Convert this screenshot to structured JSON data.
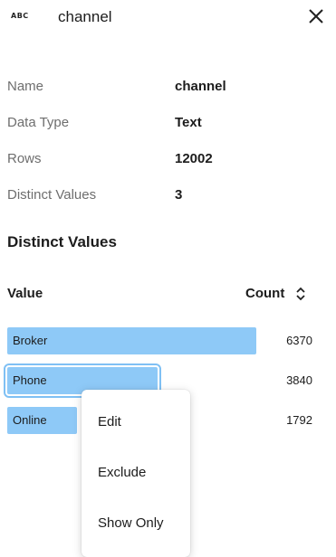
{
  "header": {
    "type_badge": "ABC",
    "title": "channel"
  },
  "properties": [
    {
      "label": "Name",
      "value": "channel"
    },
    {
      "label": "Data Type",
      "value": "Text"
    },
    {
      "label": "Rows",
      "value": "12002"
    },
    {
      "label": "Distinct Values",
      "value": "3"
    }
  ],
  "distinct": {
    "section_title": "Distinct Values",
    "value_header": "Value",
    "count_header": "Count",
    "max_count": 6370,
    "rows": [
      {
        "label": "Broker",
        "count": 6370
      },
      {
        "label": "Phone",
        "count": 3840
      },
      {
        "label": "Online",
        "count": 1792
      }
    ],
    "selected_label": "Phone"
  },
  "context_menu": {
    "items": [
      "Edit",
      "Exclude",
      "Show Only"
    ]
  },
  "colors": {
    "bar": "#8ec9f7",
    "bar_outline": "#7fc0f4"
  }
}
